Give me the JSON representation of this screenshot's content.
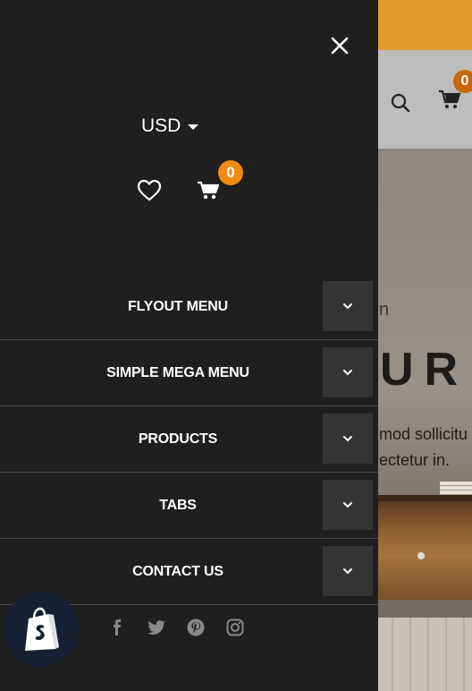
{
  "header": {
    "cart_count": "0"
  },
  "hero": {
    "line_fragment": "n",
    "heading_fragment": "UR",
    "text_line_1": "mod sollicitu",
    "text_line_2": "ectetur in."
  },
  "flyout": {
    "currency": "USD",
    "cart_count": "0",
    "menu": [
      {
        "label": "FLYOUT MENU"
      },
      {
        "label": "SIMPLE MEGA MENU"
      },
      {
        "label": "PRODUCTS"
      },
      {
        "label": "TABS"
      },
      {
        "label": "CONTACT US"
      }
    ],
    "socials": [
      "facebook-icon",
      "twitter-icon",
      "pinterest-icon",
      "instagram-icon"
    ]
  },
  "colors": {
    "accent": "#f18a15",
    "topbar": "#e39a2d",
    "panel": "#1f1f1f"
  }
}
